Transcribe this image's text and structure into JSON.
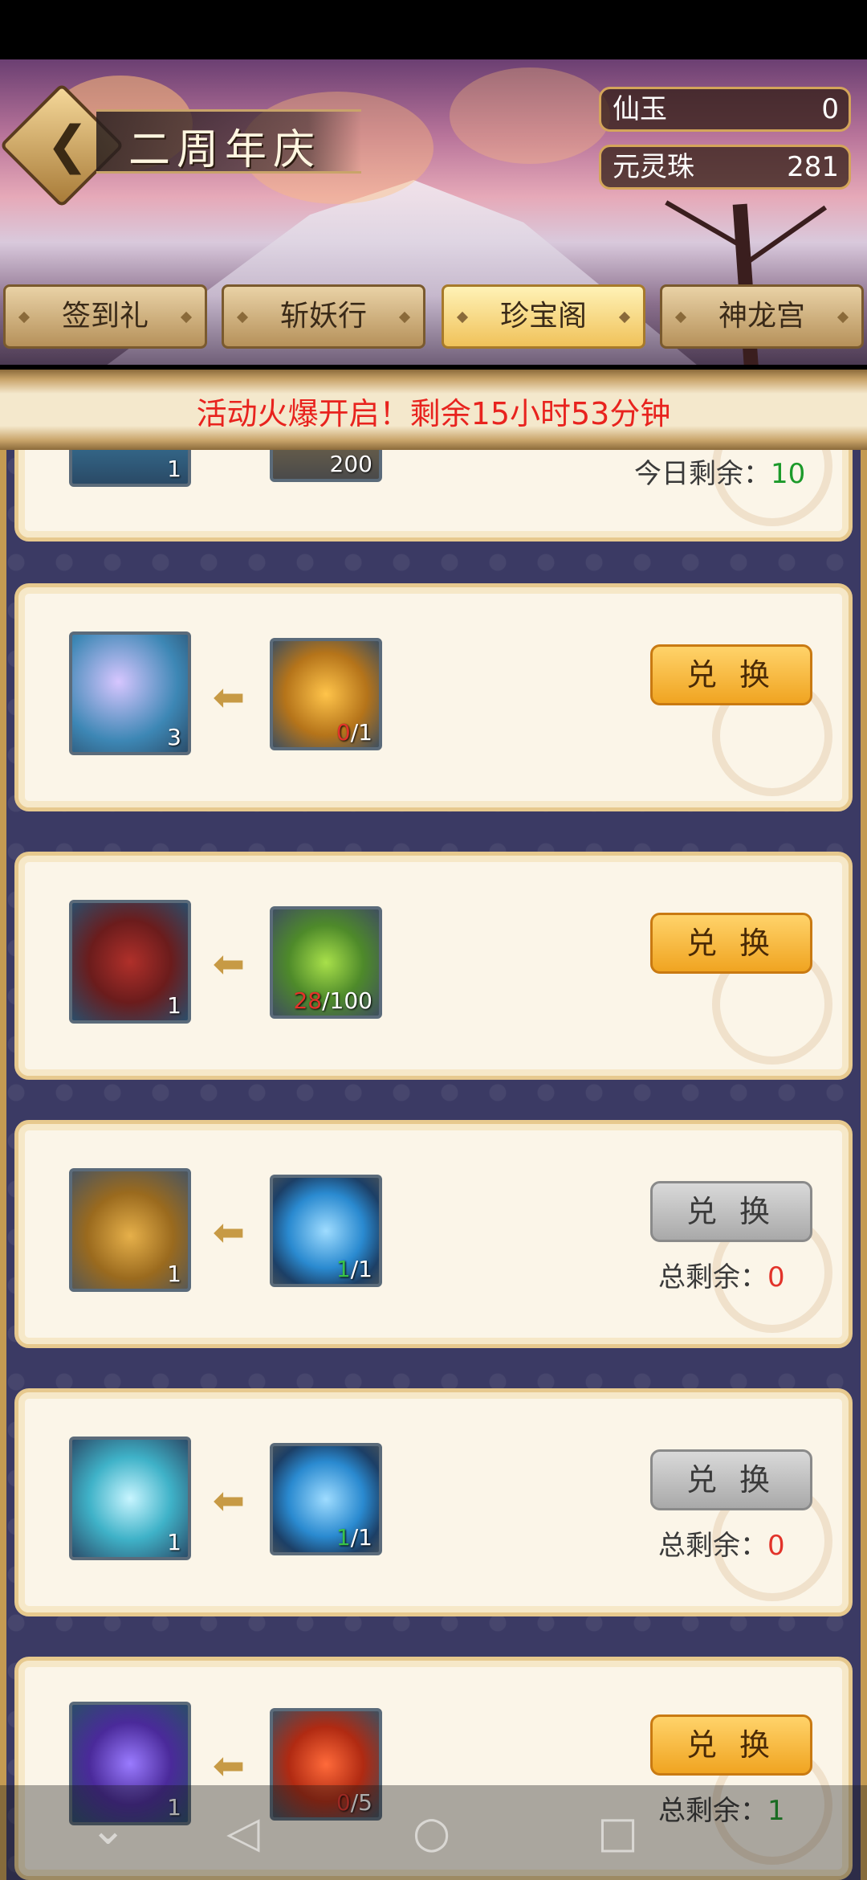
{
  "header": {
    "title": "二周年庆",
    "currencies": [
      {
        "name": "仙玉",
        "value": "0"
      },
      {
        "name": "元灵珠",
        "value": "281"
      }
    ]
  },
  "tabs": [
    {
      "label": "签到礼",
      "active": false
    },
    {
      "label": "斩妖行",
      "active": false
    },
    {
      "label": "珍宝阁",
      "active": true
    },
    {
      "label": "神龙宫",
      "active": false
    }
  ],
  "notice": "活动火爆开启！剩余15小时53分钟",
  "cards": [
    {
      "reward_count": "1",
      "cost_have": "200",
      "cost_need": "",
      "button": "",
      "remain_label": "今日剩余：",
      "remain_value": "10"
    },
    {
      "reward_count": "3",
      "cost_have": "0",
      "cost_need": "/1",
      "button": "兑 换",
      "remain_label": "",
      "remain_value": ""
    },
    {
      "reward_count": "1",
      "cost_have": "28",
      "cost_need": "/100",
      "button": "兑 换",
      "remain_label": "",
      "remain_value": ""
    },
    {
      "reward_count": "1",
      "cost_have": "1",
      "cost_need": "/1",
      "button": "兑 换",
      "remain_label": "总剩余：",
      "remain_value": "0"
    },
    {
      "reward_count": "1",
      "cost_have": "1",
      "cost_need": "/1",
      "button": "兑 换",
      "remain_label": "总剩余：",
      "remain_value": "0"
    },
    {
      "reward_count": "1",
      "cost_have": "0",
      "cost_need": "/5",
      "button": "兑 换",
      "remain_label": "总剩余：",
      "remain_value": "1"
    }
  ],
  "icons": {
    "back": "chevron-left-icon",
    "nav": [
      "nav-down-icon",
      "nav-back-icon",
      "nav-home-icon",
      "nav-recents-icon"
    ]
  }
}
